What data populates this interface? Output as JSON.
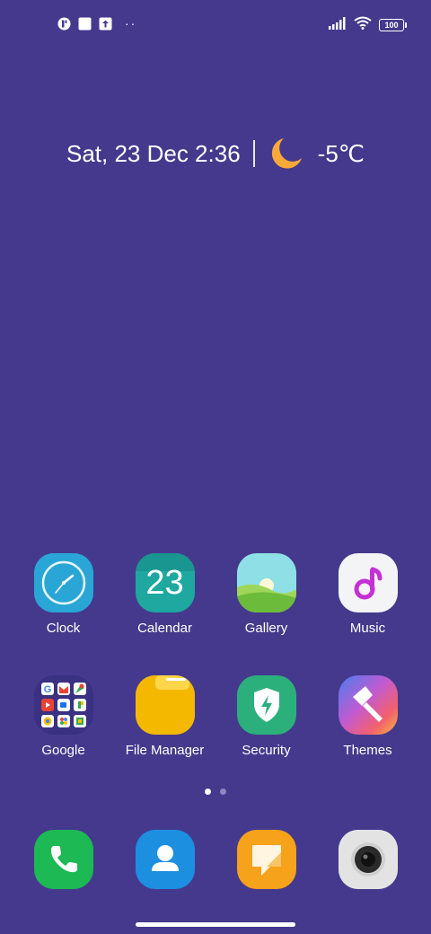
{
  "status_bar": {
    "left_icons": [
      "app-notification-icon",
      "square-notification-icon",
      "upload-icon"
    ],
    "more_dots": "··",
    "battery_level": "100",
    "right_icons": [
      "signal-icon",
      "wifi-icon",
      "battery-icon"
    ]
  },
  "widget": {
    "date_time": "Sat, 23 Dec 2:36",
    "weather_icon": "moon-icon",
    "temperature": "-5℃"
  },
  "apps": [
    {
      "label": "Clock",
      "icon": "clock-icon"
    },
    {
      "label": "Calendar",
      "icon": "calendar-icon",
      "icon_text": "23"
    },
    {
      "label": "Gallery",
      "icon": "gallery-icon"
    },
    {
      "label": "Music",
      "icon": "music-icon"
    },
    {
      "label": "Google",
      "icon": "google-folder-icon"
    },
    {
      "label": "File Manager",
      "icon": "folder-icon"
    },
    {
      "label": "Security",
      "icon": "security-shield-icon"
    },
    {
      "label": "Themes",
      "icon": "themes-brush-icon"
    }
  ],
  "page_indicator": {
    "pages": 2,
    "current": 1
  },
  "dock": [
    {
      "icon": "phone-icon"
    },
    {
      "icon": "contacts-icon"
    },
    {
      "icon": "messages-icon"
    },
    {
      "icon": "camera-icon"
    }
  ],
  "colors": {
    "wallpaper": "#45398d",
    "clock": "#2aa6d6",
    "calendar": "#1ea8a0",
    "music_note": "#c430d6",
    "file_manager": "#f5b800",
    "security": "#2bb07c",
    "phone": "#1db954",
    "contacts": "#1d8fe0",
    "messages": "#f7a21b",
    "camera": "#d9d9d9"
  }
}
